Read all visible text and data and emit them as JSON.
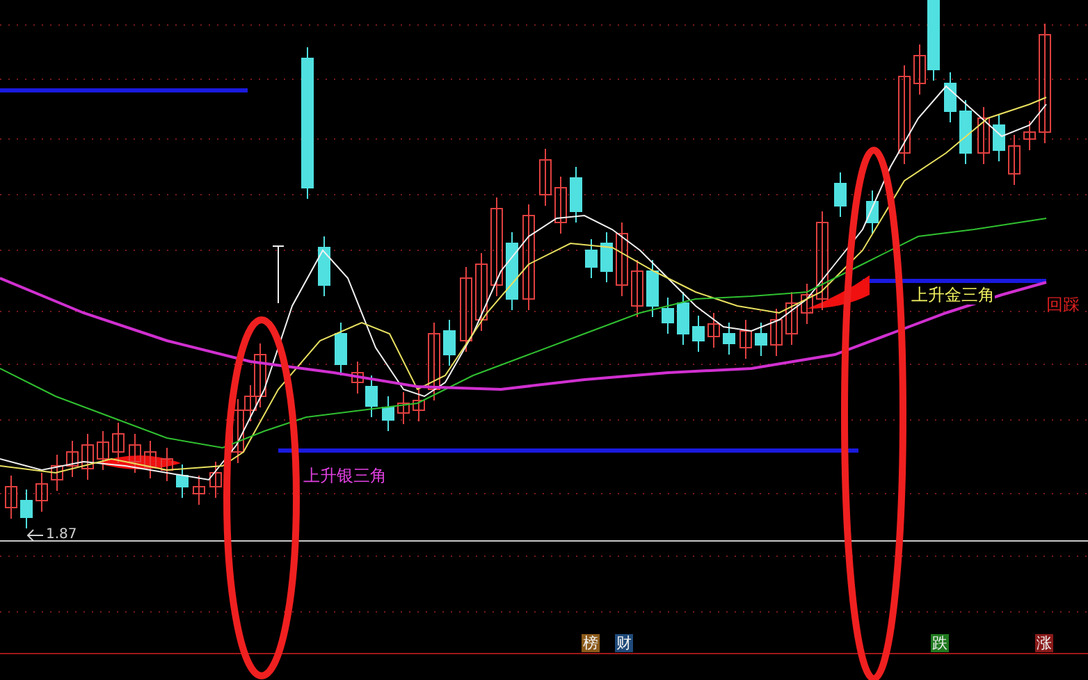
{
  "chart": {
    "low_marker": "1.87",
    "annotations": [
      {
        "text": "上升银三角",
        "color": "#e040e0"
      },
      {
        "text": "上升金三角",
        "color": "#f0f060"
      },
      {
        "text": "回踩",
        "color": "#e02020"
      }
    ]
  },
  "badges": [
    {
      "text": "榜",
      "color": "#8b5a1a"
    },
    {
      "text": "财",
      "color": "#1f4a7a"
    },
    {
      "text": "跌",
      "color": "#1f7a1f"
    },
    {
      "text": "涨",
      "color": "#8a1a1a"
    }
  ]
}
